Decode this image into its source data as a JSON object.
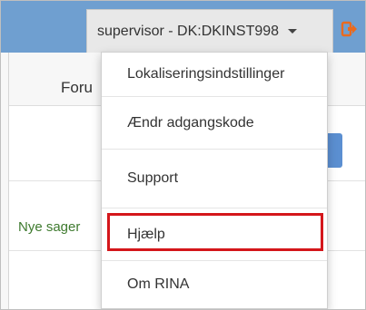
{
  "header": {
    "user_label": "supervisor - DK:DKINST998",
    "logout_color": "#ea6a1e"
  },
  "background": {
    "tab_label": "Foru",
    "side_link": "Nye sager"
  },
  "menu": {
    "items": [
      {
        "label": "Lokaliseringsindstillinger"
      },
      {
        "label": "Ændr adgangskode"
      },
      {
        "label": "Support"
      },
      {
        "label": "Hjælp",
        "highlighted": true
      },
      {
        "label": "Om RINA"
      }
    ]
  },
  "colors": {
    "topbar": "#6f9fd0",
    "highlight_border": "#d4161b",
    "link_green": "#3e7a2e"
  }
}
